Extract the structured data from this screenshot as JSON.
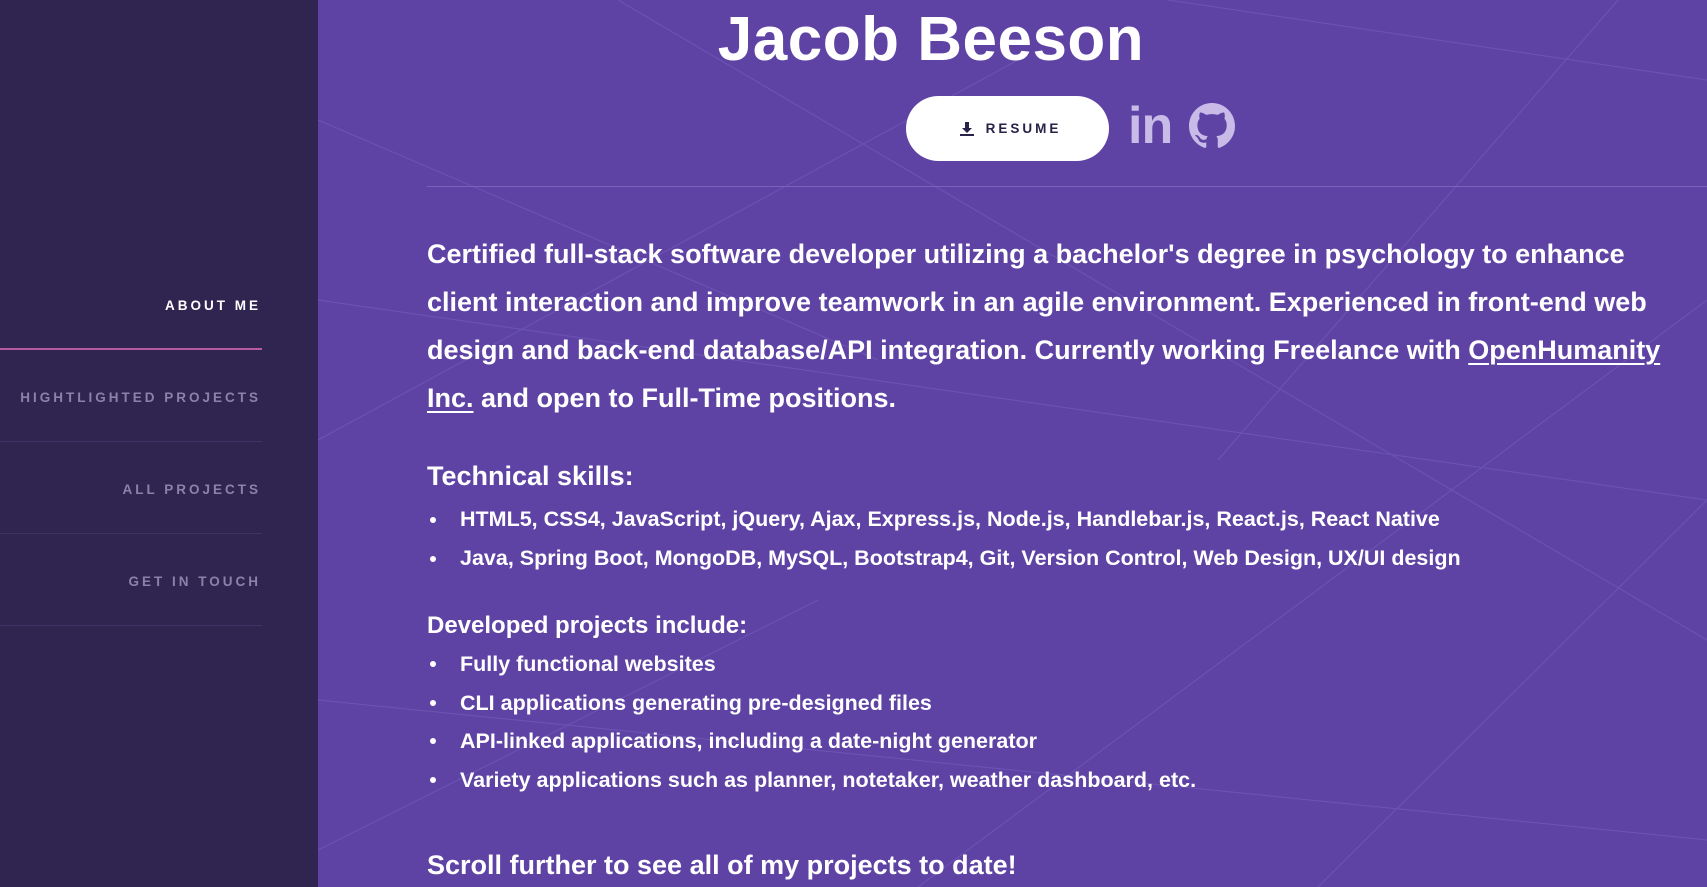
{
  "sidebar": {
    "nav": [
      {
        "label": "ABOUT ME",
        "active": true
      },
      {
        "label": "HIGHTLIGHTED PROJECTS",
        "active": false
      },
      {
        "label": "ALL PROJECTS",
        "active": false
      },
      {
        "label": "GET IN TOUCH",
        "active": false
      }
    ]
  },
  "header": {
    "name": "Jacob Beeson",
    "resume_label": "RESUME",
    "resume_icon": "download-icon",
    "social": {
      "linkedin_icon": "linkedin-icon",
      "linkedin_glyph": "in",
      "github_icon": "github-icon"
    }
  },
  "about": {
    "bio_before_link": "Certified full-stack software developer utilizing a bachelor's degree in psychology to enhance client interaction and improve teamwork in an agile environment. Experienced in front-end web design and back-end database/API integration. Currently working Freelance with ",
    "company_link": "OpenHumanity Inc.",
    "bio_after_link": " and open to Full-Time positions.",
    "skills_title": "Technical skills:",
    "skills": [
      "HTML5, CSS4, JavaScript, jQuery, Ajax, Express.js, Node.js, Handlebar.js, React.js, React Native",
      "Java, Spring Boot, MongoDB, MySQL, Bootstrap4, Git, Version Control, Web Design, UX/UI design"
    ],
    "projects_title": "Developed projects include:",
    "projects": [
      "Fully functional websites",
      "CLI applications generating pre-designed files",
      "API-linked applications, including a date-night generator",
      "Variety applications such as planner, notetaker, weather dashboard, etc."
    ],
    "scroll_cta": "Scroll further to see all of my projects to date!"
  },
  "colors": {
    "main_bg": "#5e43a5",
    "sidebar_bg": "#302550",
    "active_underline": "#b85aa3",
    "nav_inactive": "#8a82a8",
    "icon_tint": "#c8bbe8"
  }
}
